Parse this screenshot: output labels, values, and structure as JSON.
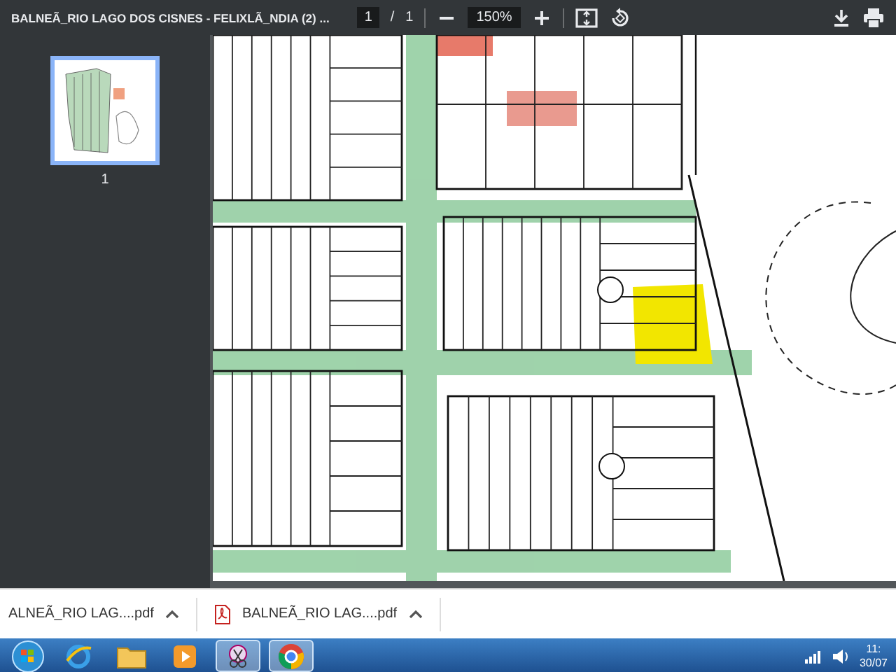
{
  "toolbar": {
    "title": "BALNEÃ_RIO LAGO DOS CISNES - FELIXLÃ_NDIA (2) ...",
    "page_current": "1",
    "page_separator": "/",
    "page_total": "1",
    "zoom": "150%"
  },
  "thumbnails": [
    {
      "label": "1",
      "selected": true
    }
  ],
  "downloads": [
    {
      "name": "ALNEÃ_RIO LAG....pdf",
      "pdf_icon": false
    },
    {
      "name": "BALNEÃ_RIO LAG....pdf",
      "pdf_icon": true
    }
  ],
  "taskbar": {
    "apps": [
      {
        "kind": "browser",
        "active": false
      },
      {
        "kind": "folder",
        "active": false
      },
      {
        "kind": "media",
        "active": false
      },
      {
        "kind": "scissors",
        "active": true
      },
      {
        "kind": "chrome",
        "active": true
      }
    ],
    "time": "11:",
    "date": "30/07"
  }
}
